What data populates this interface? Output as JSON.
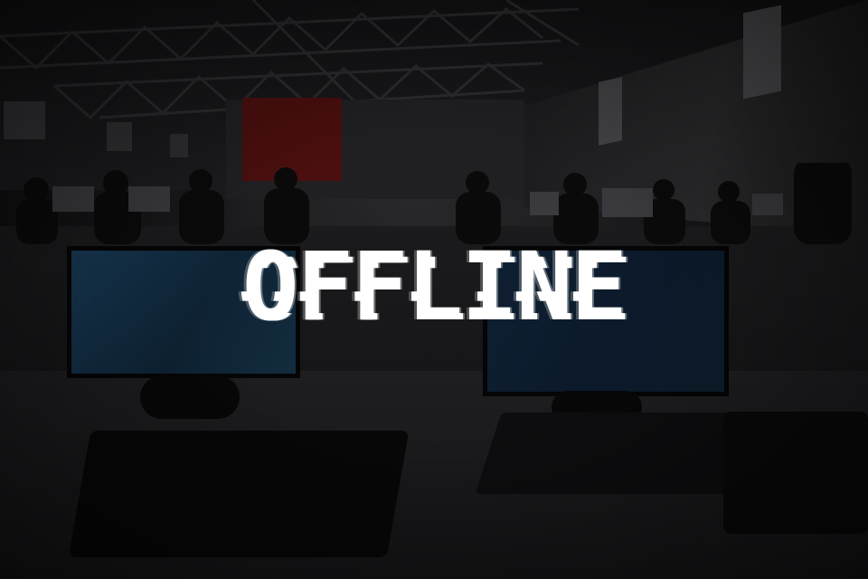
{
  "status": {
    "headline": "OFFLINE"
  },
  "colors": {
    "headline_text": "#ffffff",
    "overlay": "#0b0b0c",
    "banner_red": "#4a0f0e"
  }
}
